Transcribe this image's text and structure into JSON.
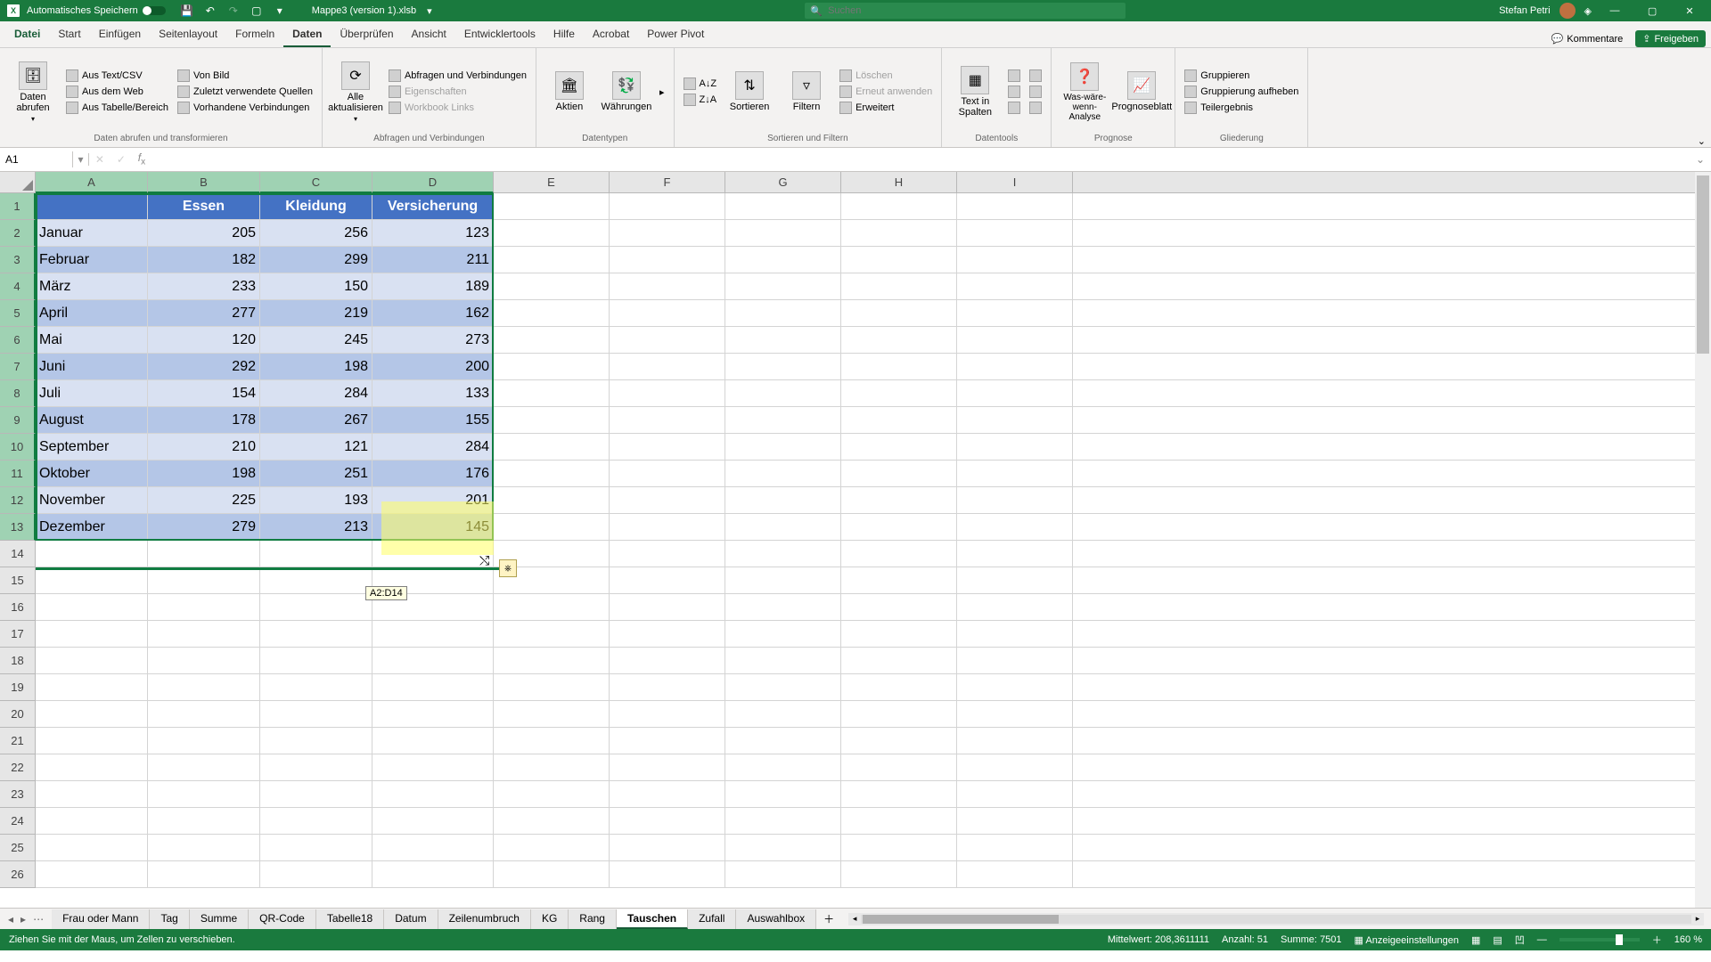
{
  "titlebar": {
    "autosave": "Automatisches Speichern",
    "filename": "Mappe3 (version 1).xlsb",
    "search_placeholder": "Suchen",
    "user": "Stefan Petri"
  },
  "ribbon_tabs": [
    "Datei",
    "Start",
    "Einfügen",
    "Seitenlayout",
    "Formeln",
    "Daten",
    "Überprüfen",
    "Ansicht",
    "Entwicklertools",
    "Hilfe",
    "Acrobat",
    "Power Pivot"
  ],
  "active_tab_index": 5,
  "comments_btn": "Kommentare",
  "share_btn": "Freigeben",
  "ribbon": {
    "grp1": {
      "big": "Daten abrufen",
      "items": [
        "Aus Text/CSV",
        "Aus dem Web",
        "Aus Tabelle/Bereich"
      ],
      "items2": [
        "Von Bild",
        "Zuletzt verwendete Quellen",
        "Vorhandene Verbindungen"
      ],
      "label": "Daten abrufen und transformieren"
    },
    "grp2": {
      "big": "Alle aktualisieren",
      "items": [
        "Abfragen und Verbindungen",
        "Eigenschaften",
        "Workbook Links"
      ],
      "label": "Abfragen und Verbindungen"
    },
    "grp3": {
      "big1": "Aktien",
      "big2": "Währungen",
      "label": "Datentypen"
    },
    "grp4": {
      "b1": "Sortieren",
      "b2": "Filtern",
      "items": [
        "Löschen",
        "Erneut anwenden",
        "Erweitert"
      ],
      "label": "Sortieren und Filtern"
    },
    "grp5": {
      "big": "Text in Spalten",
      "label": "Datentools"
    },
    "grp6": {
      "b1": "Was-wäre-wenn-Analyse",
      "b2": "Prognoseblatt",
      "label": "Prognose"
    },
    "grp7": {
      "items": [
        "Gruppieren",
        "Gruppierung aufheben",
        "Teilergebnis"
      ],
      "label": "Gliederung"
    }
  },
  "namebox": "A1",
  "columns": [
    "A",
    "B",
    "C",
    "D",
    "E",
    "F",
    "G",
    "H",
    "I"
  ],
  "chart_data": {
    "type": "table",
    "headers": [
      "",
      "Essen",
      "Kleidung",
      "Versicherung"
    ],
    "rows": [
      [
        "Januar",
        205,
        256,
        123
      ],
      [
        "Februar",
        182,
        299,
        211
      ],
      [
        "März",
        233,
        150,
        189
      ],
      [
        "April",
        277,
        219,
        162
      ],
      [
        "Mai",
        120,
        245,
        273
      ],
      [
        "Juni",
        292,
        198,
        200
      ],
      [
        "Juli",
        154,
        284,
        133
      ],
      [
        "August",
        178,
        267,
        155
      ],
      [
        "September",
        210,
        121,
        284
      ],
      [
        "Oktober",
        198,
        251,
        176
      ],
      [
        "November",
        225,
        193,
        201
      ],
      [
        "Dezember",
        279,
        213,
        145
      ]
    ]
  },
  "tooltip": "A2:D14",
  "sheet_tabs": [
    "Frau oder Mann",
    "Tag",
    "Summe",
    "QR-Code",
    "Tabelle18",
    "Datum",
    "Zeilenumbruch",
    "KG",
    "Rang",
    "Tauschen",
    "Zufall",
    "Auswahlbox"
  ],
  "active_sheet_index": 9,
  "status": {
    "hint": "Ziehen Sie mit der Maus, um Zellen zu verschieben.",
    "avg_label": "Mittelwert:",
    "avg": "208,3611111",
    "count_label": "Anzahl:",
    "count": "51",
    "sum_label": "Summe:",
    "sum": "7501",
    "display": "Anzeigeeinstellungen",
    "zoom": "160 %"
  }
}
